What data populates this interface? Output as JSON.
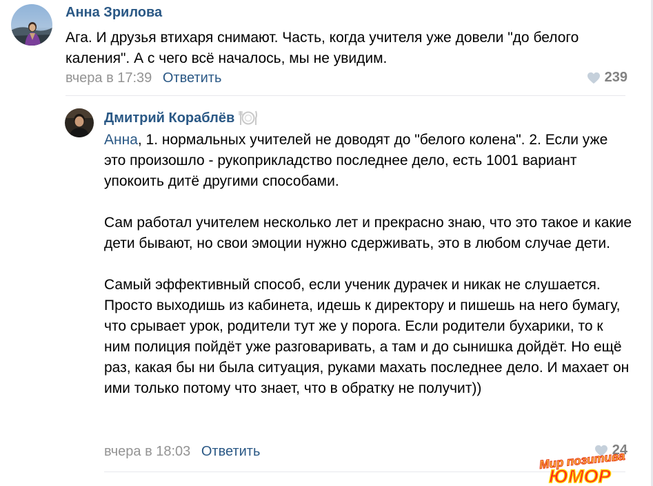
{
  "comments": [
    {
      "author": "Анна Зрилова",
      "text": "Ага. И друзья втихаря снимают. Часть, когда учителя уже довели \"до белого каления\". А с чего всё началось, мы не увидим.",
      "date": "вчера в 17:39",
      "reply_label": "Ответить",
      "likes": "239",
      "avatar_icon": "user-photo-avatar"
    },
    {
      "author": "Дмитрий Кораблёв",
      "author_badge_icon": "plate-fork-knife-icon",
      "mention": "Анна",
      "paragraphs": [
        ", 1. нормальных учителей не доводят до \"белого колена\". 2. Если уже это произошло - рукоприкладство последнее дело, есть 1001 вариант упокоить дитё другими способами.",
        "Сам работал учителем несколько лет и прекрасно знаю, что это такое и какие дети бывают, но свои эмоции нужно сдерживать, это в любом случае дети.",
        "Самый эффективный способ, если ученик дурачек и никак не слушается. Просто выходишь из кабинета, идешь к директору и пишешь на него бумагу, что срывает урок, родители тут же у порога. Если родители бухарики, то к ним полиция пойдёт уже разговаривать, а там и до сынишка дойдёт. Но ещё раз, какая бы ни была ситуация, руками махать последнее дело. И махает он ими только потому что знает, что в обратку не получит))"
      ],
      "date": "вчера в 18:03",
      "reply_label": "Ответить",
      "likes": "24",
      "avatar_icon": "user-photo-avatar"
    }
  ],
  "watermark": {
    "top_text": "Мир позитива",
    "bottom_text": "ЮМОР"
  },
  "colors": {
    "link": "#2a5885",
    "meta": "#939393",
    "likes": "#828282",
    "divider": "#e7e8ec"
  }
}
